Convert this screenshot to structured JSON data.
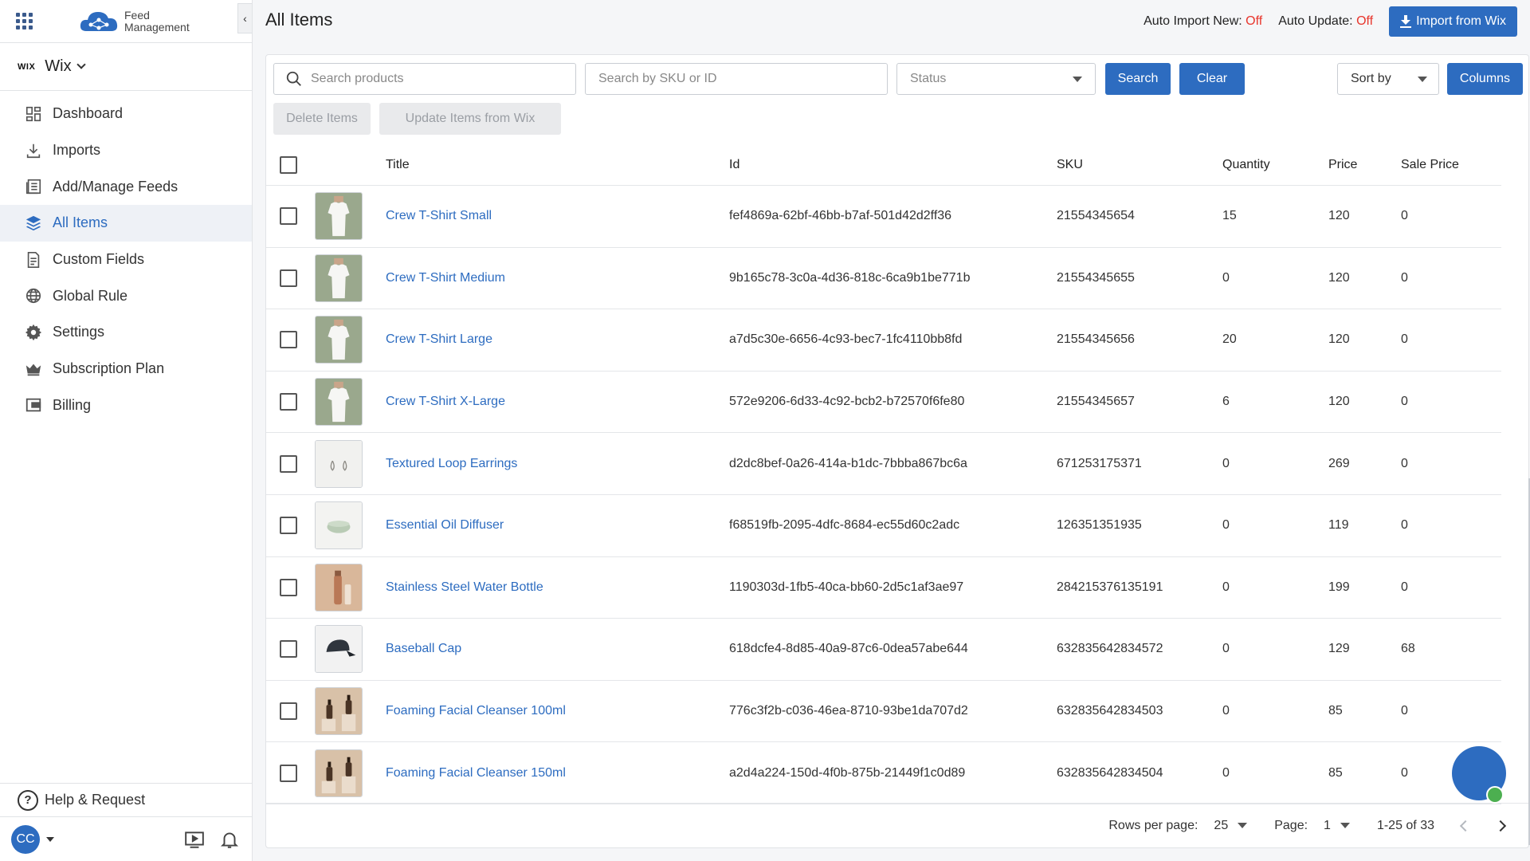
{
  "app": {
    "logo_line1": "Feed",
    "logo_line2": "Management"
  },
  "store": {
    "logo_text": "WIX",
    "name": "Wix"
  },
  "sidebar": {
    "items": [
      {
        "label": "Dashboard",
        "icon": "dashboard-icon"
      },
      {
        "label": "Imports",
        "icon": "download-icon"
      },
      {
        "label": "Add/Manage Feeds",
        "icon": "feeds-icon"
      },
      {
        "label": "All Items",
        "icon": "layers-icon",
        "active": true
      },
      {
        "label": "Custom Fields",
        "icon": "document-icon"
      },
      {
        "label": "Global Rule",
        "icon": "globe-icon"
      },
      {
        "label": "Settings",
        "icon": "gear-icon"
      },
      {
        "label": "Subscription Plan",
        "icon": "crown-icon"
      },
      {
        "label": "Billing",
        "icon": "wallet-icon"
      }
    ],
    "help_label": "Help & Request",
    "user_initials": "CC"
  },
  "header": {
    "title": "All Items",
    "auto_import_label": "Auto Import New:",
    "auto_import_value": "Off",
    "auto_update_label": "Auto Update:",
    "auto_update_value": "Off",
    "import_button": "Import from Wix"
  },
  "toolbar": {
    "search_placeholder": "Search products",
    "sku_placeholder": "Search by SKU or ID",
    "status_placeholder": "Status",
    "search_button": "Search",
    "clear_button": "Clear",
    "sort_label": "Sort by",
    "columns_button": "Columns",
    "delete_button": "Delete Items",
    "update_button": "Update Items from Wix"
  },
  "table": {
    "columns": [
      "Title",
      "Id",
      "SKU",
      "Quantity",
      "Price",
      "Sale Price"
    ],
    "rows": [
      {
        "title": "Crew T-Shirt Small",
        "id": "fef4869a-62bf-46bb-b7af-501d42d2ff36",
        "sku": "21554345654",
        "quantity": "15",
        "price": "120",
        "sale_price": "0",
        "thumb": "tshirt"
      },
      {
        "title": "Crew T-Shirt Medium",
        "id": "9b165c78-3c0a-4d36-818c-6ca9b1be771b",
        "sku": "21554345655",
        "quantity": "0",
        "price": "120",
        "sale_price": "0",
        "thumb": "tshirt"
      },
      {
        "title": "Crew T-Shirt Large",
        "id": "a7d5c30e-6656-4c93-bec7-1fc4110bb8fd",
        "sku": "21554345656",
        "quantity": "20",
        "price": "120",
        "sale_price": "0",
        "thumb": "tshirt"
      },
      {
        "title": "Crew T-Shirt X-Large",
        "id": "572e9206-6d33-4c92-bcb2-b72570f6fe80",
        "sku": "21554345657",
        "quantity": "6",
        "price": "120",
        "sale_price": "0",
        "thumb": "tshirt"
      },
      {
        "title": "Textured Loop Earrings",
        "id": "d2dc8bef-0a26-414a-b1dc-7bbba867bc6a",
        "sku": "671253175371",
        "quantity": "0",
        "price": "269",
        "sale_price": "0",
        "thumb": "earrings"
      },
      {
        "title": "Essential Oil Diffuser",
        "id": "f68519fb-2095-4dfc-8684-ec55d60c2adc",
        "sku": "126351351935",
        "quantity": "0",
        "price": "119",
        "sale_price": "0",
        "thumb": "diffuser"
      },
      {
        "title": "Stainless Steel Water Bottle",
        "id": "1190303d-1fb5-40ca-bb60-2d5c1af3ae97",
        "sku": "284215376135191",
        "quantity": "0",
        "price": "199",
        "sale_price": "0",
        "thumb": "bottle"
      },
      {
        "title": "Baseball Cap",
        "id": "618dcfe4-8d85-40a9-87c6-0dea57abe644",
        "sku": "632835642834572",
        "quantity": "0",
        "price": "129",
        "sale_price": "68",
        "thumb": "cap"
      },
      {
        "title": "Foaming Facial Cleanser 100ml",
        "id": "776c3f2b-c036-46ea-8710-93be1da707d2",
        "sku": "632835642834503",
        "quantity": "0",
        "price": "85",
        "sale_price": "0",
        "thumb": "cleanser"
      },
      {
        "title": "Foaming Facial Cleanser 150ml",
        "id": "a2d4a224-150d-4f0b-875b-21449f1c0d89",
        "sku": "632835642834504",
        "quantity": "0",
        "price": "85",
        "sale_price": "0",
        "thumb": "cleanser"
      }
    ]
  },
  "pagination": {
    "rows_per_page_label": "Rows per page:",
    "rows_per_page": "25",
    "page_label": "Page:",
    "page": "1",
    "range": "1-25 of 33"
  },
  "colors": {
    "accent": "#2d6cc0",
    "off": "#e8352c",
    "online": "#4caf50"
  }
}
